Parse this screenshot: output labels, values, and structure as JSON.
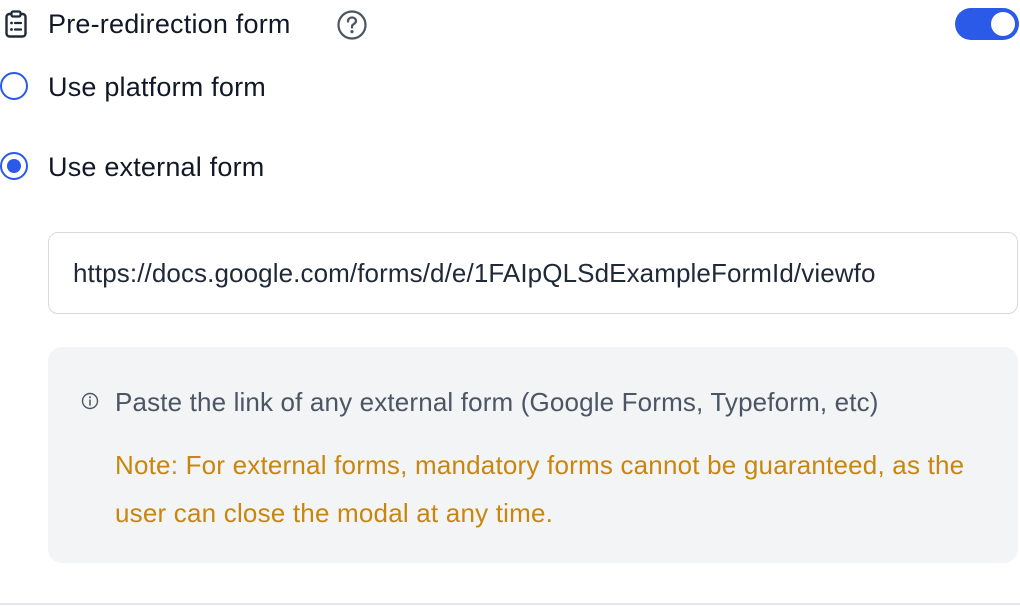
{
  "section": {
    "title": "Pre-redirection form",
    "enabled": true,
    "icons": {
      "leading": "clipboard-icon",
      "help": "help-circle-icon"
    }
  },
  "options": {
    "platform": {
      "label": "Use platform form",
      "selected": false
    },
    "external": {
      "label": "Use external form",
      "selected": true
    }
  },
  "external_form": {
    "url": "https://docs.google.com/forms/d/e/1FAIpQLSdExampleFormId/viewfo"
  },
  "info": {
    "icon": "info-icon",
    "hint": "Paste the link of any external form (Google Forms, Typeform, etc)",
    "note": "Note: For external forms, mandatory forms cannot be guaranteed, as the user can close the modal at any time."
  },
  "colors": {
    "accent": "#2b59e8",
    "note": "#c8870c",
    "info_bg": "#f3f4f6"
  }
}
